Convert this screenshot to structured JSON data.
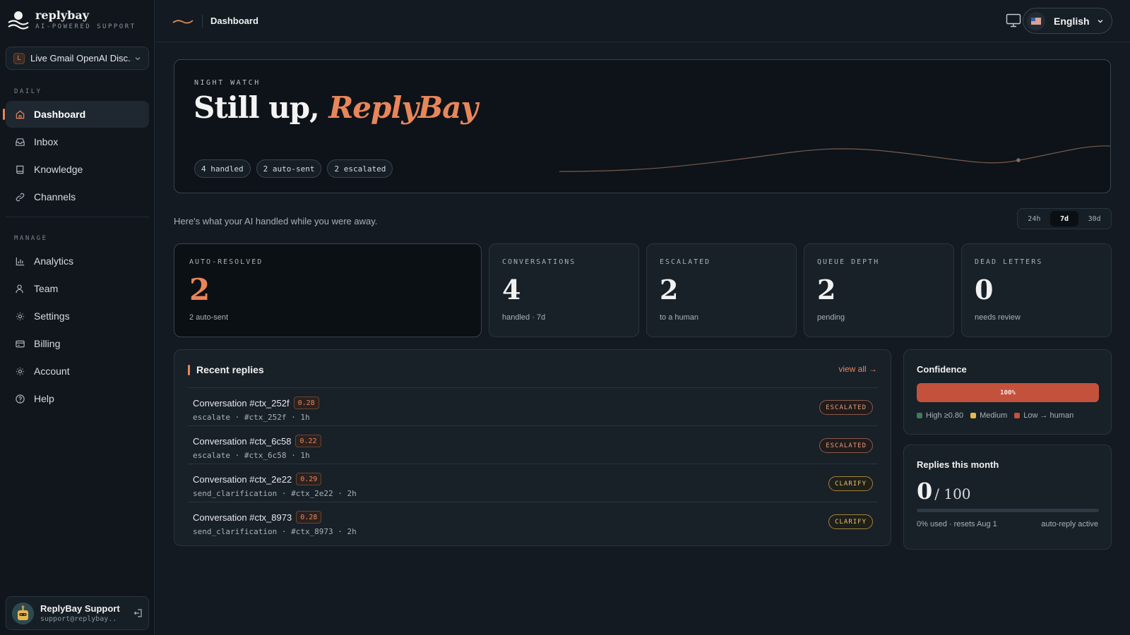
{
  "brand": {
    "name": "replybay",
    "tagline": "AI-POWERED SUPPORT"
  },
  "workspace": {
    "badge": "L",
    "name": "Live Gmail OpenAI Disc..."
  },
  "sidebar": {
    "daily_label": "DAILY",
    "manage_label": "MANAGE",
    "daily_items": [
      {
        "label": "Dashboard",
        "icon": "home-icon",
        "active": true
      },
      {
        "label": "Inbox",
        "icon": "inbox-icon"
      },
      {
        "label": "Knowledge",
        "icon": "book-icon"
      },
      {
        "label": "Channels",
        "icon": "link-icon"
      }
    ],
    "manage_items": [
      {
        "label": "Analytics",
        "icon": "bar-chart-icon"
      },
      {
        "label": "Team",
        "icon": "user-icon"
      },
      {
        "label": "Settings",
        "icon": "gear-icon"
      },
      {
        "label": "Billing",
        "icon": "card-icon"
      },
      {
        "label": "Account",
        "icon": "gear-icon"
      },
      {
        "label": "Help",
        "icon": "help-icon"
      }
    ]
  },
  "user": {
    "name": "ReplyBay Support",
    "email": "support@replybay...."
  },
  "topbar": {
    "title": "Dashboard",
    "language": "English"
  },
  "hero": {
    "kicker": "NIGHT WATCH",
    "title_prefix": "Still up, ",
    "title_name": "ReplyBay",
    "chips": [
      "4 handled",
      "2 auto-sent",
      "2 escalated"
    ]
  },
  "subtitle": "Here's what your AI handled while you were away.",
  "range": {
    "options": [
      "24h",
      "7d",
      "30d"
    ],
    "selected": "7d"
  },
  "stats": [
    {
      "label": "AUTO-RESOLVED",
      "value": "2",
      "sub": "2 auto-sent"
    },
    {
      "label": "CONVERSATIONS",
      "value": "4",
      "sub": "handled · 7d"
    },
    {
      "label": "ESCALATED",
      "value": "2",
      "sub": "to a human"
    },
    {
      "label": "QUEUE DEPTH",
      "value": "2",
      "sub": "pending"
    },
    {
      "label": "DEAD LETTERS",
      "value": "0",
      "sub": "needs review"
    }
  ],
  "recent": {
    "title": "Recent replies",
    "view_all": "view all →",
    "rows": [
      {
        "name": "Conversation #ctx_252f",
        "score": "0.28",
        "meta": "escalate · #ctx_252f · 1h",
        "status": "ESCALATED",
        "kind": "escalated"
      },
      {
        "name": "Conversation #ctx_6c58",
        "score": "0.22",
        "meta": "escalate · #ctx_6c58 · 1h",
        "status": "ESCALATED",
        "kind": "escalated"
      },
      {
        "name": "Conversation #ctx_2e22",
        "score": "0.29",
        "meta": "send_clarification · #ctx_2e22 · 2h",
        "status": "CLARIFY",
        "kind": "clarify"
      },
      {
        "name": "Conversation #ctx_8973",
        "score": "0.28",
        "meta": "send_clarification · #ctx_8973 · 2h",
        "status": "CLARIFY",
        "kind": "clarify"
      }
    ]
  },
  "confidence": {
    "title": "Confidence",
    "bar_label": "100%",
    "bar_fraction": 1.0,
    "legend": [
      {
        "label": "High ≥0.80",
        "color": "#3f7a5e"
      },
      {
        "label": "Medium",
        "color": "#e6b84a"
      },
      {
        "label": "Low → human",
        "color": "#c4513c"
      }
    ]
  },
  "month": {
    "title": "Replies this month",
    "used": "0",
    "limit": "/ 100",
    "used_fraction": 0,
    "left_note": "0% used · resets Aug 1",
    "right_note": "auto-reply active"
  },
  "colors": {
    "accent": "#e8865a",
    "danger": "#c4513c",
    "warning": "#e6c26a"
  }
}
